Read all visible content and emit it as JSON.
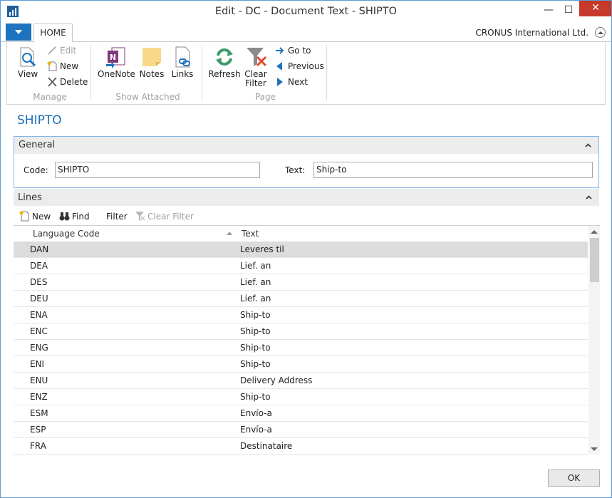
{
  "window": {
    "title": "Edit - DC - Document Text - SHIPTO",
    "minimize_glyph": "—",
    "maximize_glyph": "☐",
    "close_glyph": "✕"
  },
  "ribbon": {
    "tab": "HOME",
    "company": "CRONUS International Ltd.",
    "groups": {
      "manage": {
        "label": "Manage",
        "view": "View",
        "edit": "Edit",
        "new": "New",
        "delete": "Delete"
      },
      "show_attached": {
        "label": "Show Attached",
        "onenote": "OneNote",
        "notes": "Notes",
        "links": "Links"
      },
      "page": {
        "label": "Page",
        "refresh": "Refresh",
        "clear_filter_line1": "Clear",
        "clear_filter_line2": "Filter",
        "goto": "Go to",
        "previous": "Previous",
        "next": "Next"
      }
    }
  },
  "page": {
    "title": "SHIPTO"
  },
  "general": {
    "title": "General",
    "code_label": "Code:",
    "code_value": "SHIPTO",
    "text_label": "Text:",
    "text_value": "Ship-to"
  },
  "lines": {
    "title": "Lines",
    "toolbar": {
      "new": "New",
      "find": "Find",
      "filter": "Filter",
      "clear_filter": "Clear Filter"
    },
    "columns": [
      "Language Code",
      "Text"
    ],
    "rows": [
      {
        "code": "DAN",
        "text": "Leveres til"
      },
      {
        "code": "DEA",
        "text": "Lief. an"
      },
      {
        "code": "DES",
        "text": "Lief. an"
      },
      {
        "code": "DEU",
        "text": "Lief. an"
      },
      {
        "code": "ENA",
        "text": "Ship-to"
      },
      {
        "code": "ENC",
        "text": "Ship-to"
      },
      {
        "code": "ENG",
        "text": "Ship-to"
      },
      {
        "code": "ENI",
        "text": "Ship-to"
      },
      {
        "code": "ENU",
        "text": "Delivery Address"
      },
      {
        "code": "ENZ",
        "text": "Ship-to"
      },
      {
        "code": "ESM",
        "text": "Envío-a"
      },
      {
        "code": "ESP",
        "text": "Envío-a"
      },
      {
        "code": "FRA",
        "text": "Destinataire"
      }
    ]
  },
  "footer": {
    "ok": "OK"
  },
  "colors": {
    "accent": "#1e73be",
    "title_blue": "#1c6fb8",
    "close_red": "#c7392a",
    "selected_row": "#dcdcdc"
  }
}
